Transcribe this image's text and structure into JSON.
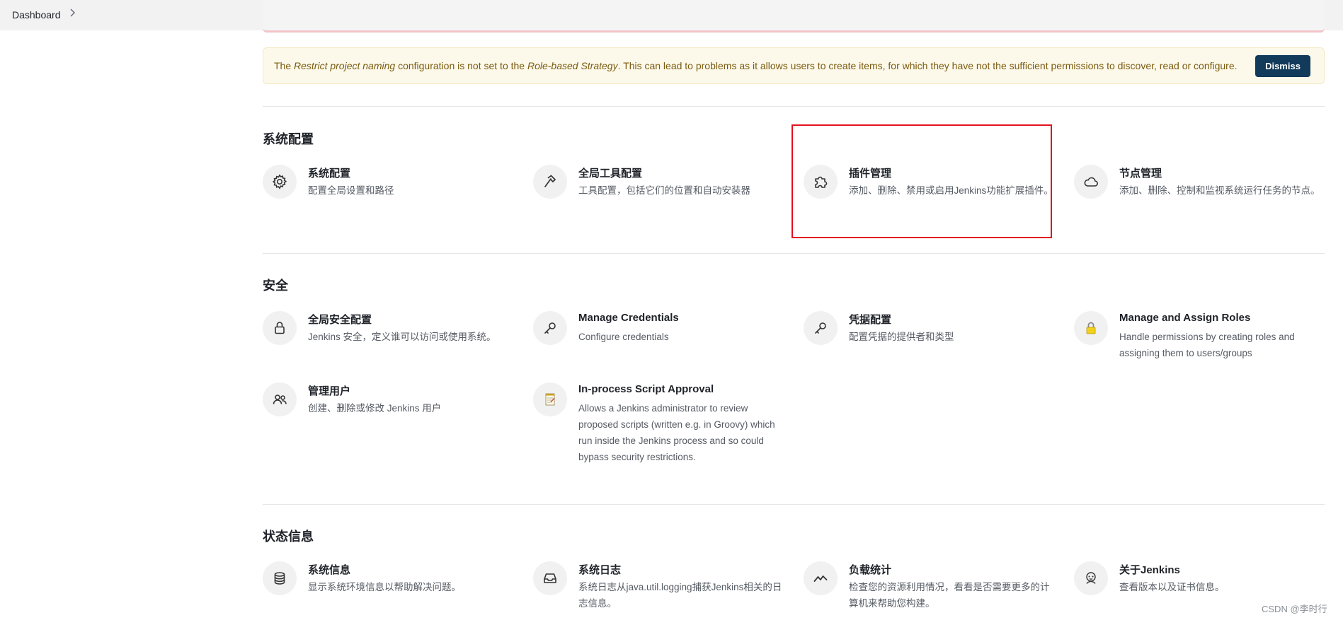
{
  "breadcrumb": {
    "label": "Dashboard"
  },
  "warning": {
    "text_1": "The ",
    "em_1": "Restrict project naming",
    "text_2": " configuration is not set to the ",
    "em_2": "Role-based Strategy",
    "text_3": ". This can lead to problems as it allows users to create items, for which they have not the sufficient permissions to discover, read or configure.",
    "dismiss_label": "Dismiss"
  },
  "sections": [
    {
      "title": "系统配置",
      "items": [
        {
          "title": "系统配置",
          "desc": "配置全局设置和路径",
          "icon": "gear-icon"
        },
        {
          "title": "全局工具配置",
          "desc": "工具配置，包括它们的位置和自动安装器",
          "icon": "hammer-icon"
        },
        {
          "title": "插件管理",
          "desc": "添加、删除、禁用或启用Jenkins功能扩展插件。",
          "icon": "puzzle-icon"
        },
        {
          "title": "节点管理",
          "desc": "添加、删除、控制和监视系统运行任务的节点。",
          "icon": "cloud-icon"
        }
      ]
    },
    {
      "title": "安全",
      "items": [
        {
          "title": "全局安全配置",
          "desc": "Jenkins 安全，定义谁可以访问或使用系统。",
          "icon": "lock-icon"
        },
        {
          "title": "Manage Credentials",
          "desc": "Configure credentials",
          "icon": "key-icon"
        },
        {
          "title": "凭据配置",
          "desc": "配置凭据的提供者和类型",
          "icon": "key-icon"
        },
        {
          "title": "Manage and Assign Roles",
          "desc": "Handle permissions by creating roles and assigning them to users/groups",
          "icon": "padlock-icon"
        },
        {
          "title": "管理用户",
          "desc": "创建、删除或修改 Jenkins 用户",
          "icon": "users-icon"
        },
        {
          "title": "In-process Script Approval",
          "desc": "Allows a Jenkins administrator to review proposed scripts (written e.g. in Groovy) which run inside the Jenkins process and so could bypass security restrictions.",
          "icon": "notepad-icon"
        }
      ]
    },
    {
      "title": "状态信息",
      "items": [
        {
          "title": "系统信息",
          "desc": "显示系统环境信息以帮助解决问题。",
          "icon": "database-icon"
        },
        {
          "title": "系统日志",
          "desc": "系统日志从java.util.logging捕获Jenkins相关的日志信息。",
          "icon": "inbox-icon"
        },
        {
          "title": "负载统计",
          "desc": "检查您的资源利用情况，看看是否需要更多的计算机来帮助您构建。",
          "icon": "chart-line-icon"
        },
        {
          "title": "关于Jenkins",
          "desc": "查看版本以及证书信息。",
          "icon": "jenkins-icon"
        }
      ]
    }
  ],
  "watermark": "CSDN @李时行"
}
